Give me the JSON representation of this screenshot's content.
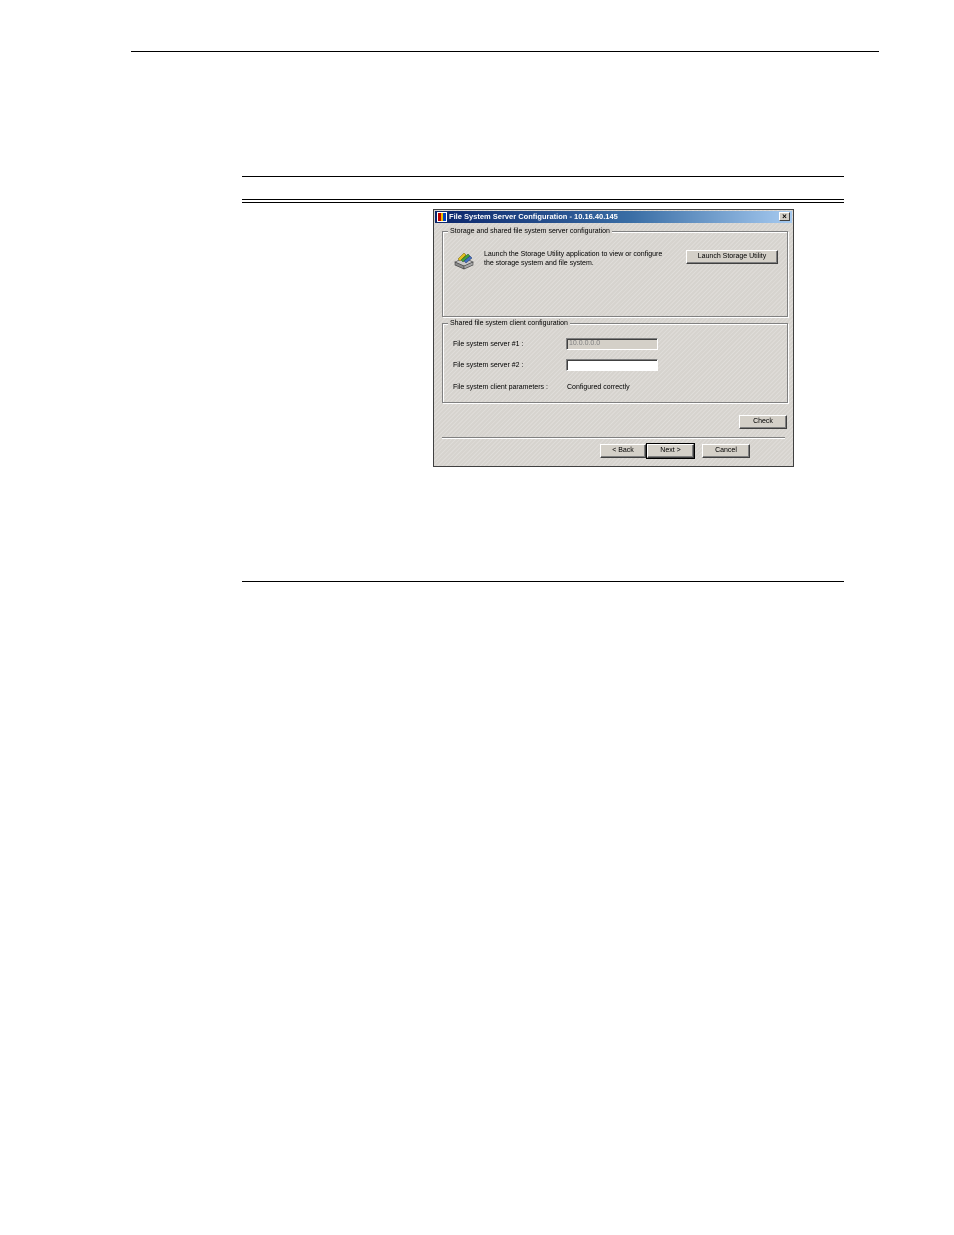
{
  "dialog": {
    "title": "File System Server Configuration - 10.16.40.145",
    "icon": "app-window-icon",
    "close_label": "×",
    "storage_group": {
      "label": "Storage and shared file system server configuration",
      "description_line1": "Launch the Storage Utility application to view or configure",
      "description_line2": "the storage system and file system.",
      "icon": "storage-disk-icon",
      "launch_button_label": "Launch Storage Utility"
    },
    "client_group": {
      "label": "Shared file system client configuration",
      "server1_label": "File system server #1 :",
      "server1_value": "10.0.0.0.0",
      "server2_label": "File system server #2 :",
      "server2_value": "",
      "params_label": "File system client parameters :",
      "params_value": "Configured correctly"
    },
    "buttons": {
      "check": "Check",
      "back": "< Back",
      "next": "Next >",
      "cancel": "Cancel"
    }
  }
}
